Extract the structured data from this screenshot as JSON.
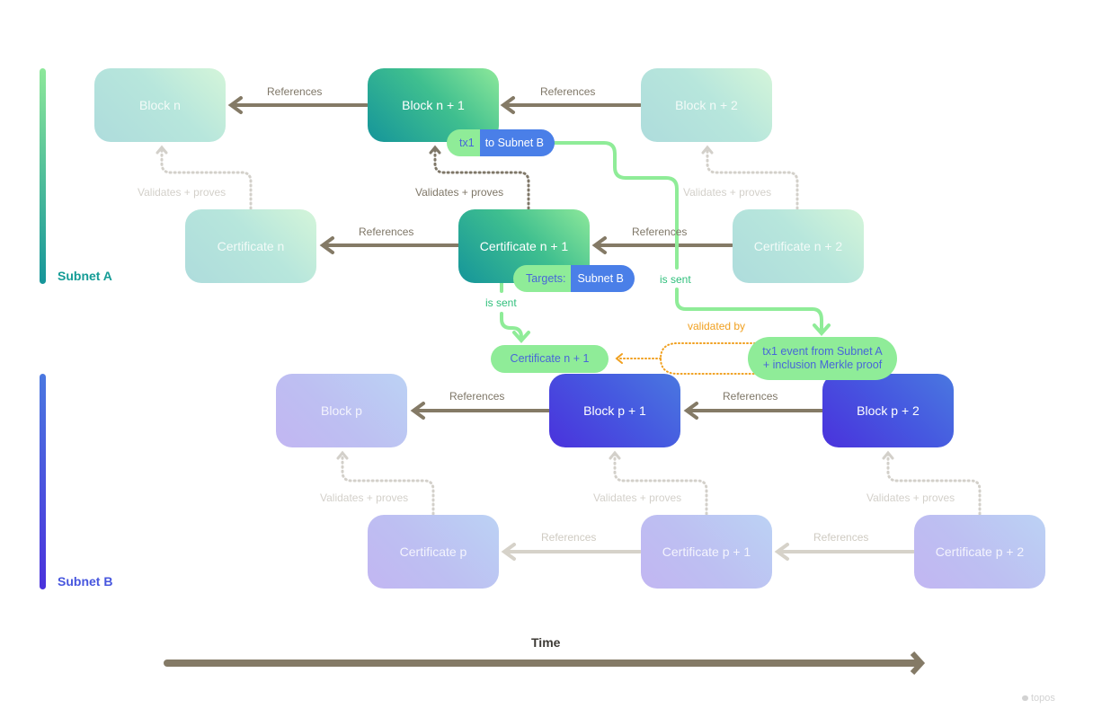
{
  "subnets": {
    "a": {
      "label": "Subnet A",
      "color": "#159c96"
    },
    "b": {
      "label": "Subnet B",
      "color": "#4756de"
    }
  },
  "subnet_a": {
    "blocks": [
      "Block n",
      "Block n + 1",
      "Block n + 2"
    ],
    "certificates": [
      "Certificate n",
      "Certificate n + 1",
      "Certificate n + 2"
    ]
  },
  "subnet_b": {
    "blocks": [
      "Block p",
      "Block p + 1",
      "Block p + 2"
    ],
    "certificates": [
      "Certificate p",
      "Certificate p + 1",
      "Certificate p + 2"
    ]
  },
  "edge_labels": {
    "references": "References",
    "validates_proves": "Validates + proves",
    "is_sent": "is sent",
    "validated_by": "validated by"
  },
  "tx_pill": {
    "left": "tx1",
    "right": "to Subnet B"
  },
  "targets_pill": {
    "left": "Targets:",
    "right": "Subnet B"
  },
  "received_certificate": "Certificate n + 1",
  "event_proof": {
    "line1": "tx1 event from Subnet A",
    "line2": "+ inclusion Merkle proof"
  },
  "time_axis": {
    "label": "Time"
  },
  "watermark": "topos",
  "colors": {
    "reference_arrow": "#847a66",
    "reference_arrow_faded": "#d6d2c9",
    "send_path": "#8fec98",
    "validated_by": "#f0a020"
  }
}
